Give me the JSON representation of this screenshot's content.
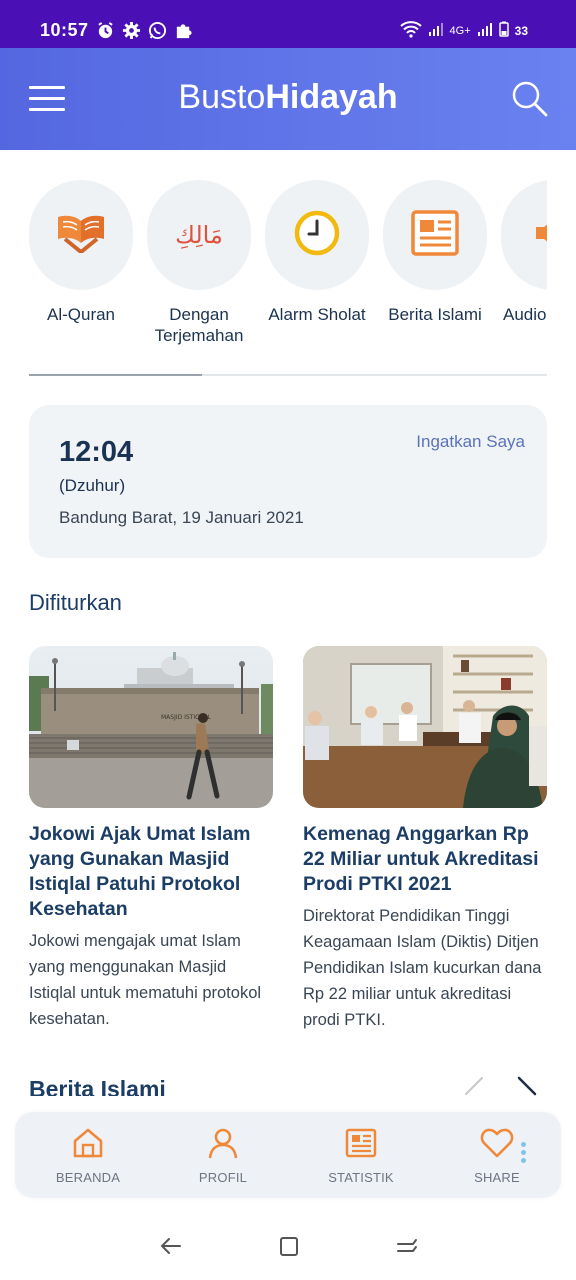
{
  "status_bar": {
    "time": "10:57",
    "left_icons": [
      "alarm-icon",
      "gear-icon",
      "whatsapp-icon",
      "puzzle-icon"
    ],
    "network": "4G+",
    "battery": "33"
  },
  "app_bar": {
    "title_light": "Busto",
    "title_bold": "Hidayah",
    "menu_icon": "hamburger-menu-icon",
    "search_icon": "search-icon"
  },
  "features": [
    {
      "label": "Al-Quran",
      "icon": "quran-book-icon"
    },
    {
      "label": "Dengan Terjemahan",
      "icon": "arabic-calligraphy-icon",
      "glyph": "مَالِكِ"
    },
    {
      "label": "Alarm Sholat",
      "icon": "clock-icon"
    },
    {
      "label": "Berita Islami",
      "icon": "newspaper-icon"
    },
    {
      "label": "Audio",
      "icon": "speaker-icon"
    }
  ],
  "prayer": {
    "time": "12:04",
    "name": "(Dzuhur)",
    "location_date": "Bandung Barat, 19 Januari 2021",
    "remind_label": "Ingatkan Saya"
  },
  "featured": {
    "title": "Difiturkan",
    "items": [
      {
        "headline": "Jokowi Ajak Umat Islam yang Gunakan Masjid Istiqlal Patuhi Protokol Kesehatan",
        "desc": "Jokowi mengajak umat Islam yang menggunakan Masjid Istiqlal untuk mematuhi protokol kesehatan.",
        "sign_text": "MASJID ISTIQLAL"
      },
      {
        "headline": "Kemenag Anggarkan Rp 22 Miliar untuk Akreditasi Prodi PTKI 2021",
        "desc": "Direktorat Pendidikan Tinggi Keagamaan Islam (Diktis) Ditjen Pendidikan Islam kucurkan dana Rp 22 miliar untuk akreditasi prodi PTKI."
      }
    ]
  },
  "more_section": {
    "title": "Berita Islami"
  },
  "bottom_nav": [
    {
      "label": "BERANDA",
      "icon": "home-icon"
    },
    {
      "label": "PROFIL",
      "icon": "user-icon"
    },
    {
      "label": "STATISTIK",
      "icon": "newspaper-icon"
    },
    {
      "label": "SHARE",
      "icon": "heart-icon"
    }
  ],
  "colors": {
    "status_bar": "#4a0fb5",
    "app_bar_start": "#5467e0",
    "app_bar_end": "#6a82f0",
    "accent_orange": "#f0883a",
    "heading_blue": "#1b3d66",
    "link_blue": "#5b73b8"
  }
}
